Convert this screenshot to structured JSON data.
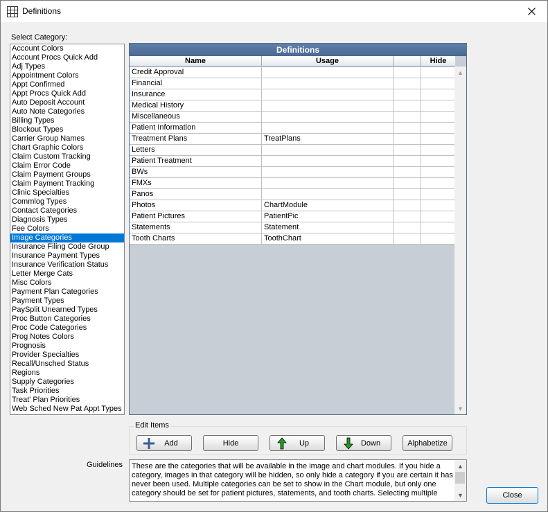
{
  "window": {
    "title": "Definitions",
    "icon": "grid-icon",
    "close_icon": "close-icon"
  },
  "category_label": "Select Category:",
  "categories": [
    "Account Colors",
    "Account Procs Quick Add",
    "Adj Types",
    "Appointment Colors",
    "Appt Confirmed",
    "Appt Procs Quick Add",
    "Auto Deposit Account",
    "Auto Note Categories",
    "Billing Types",
    "Blockout Types",
    "Carrier Group Names",
    "Chart Graphic Colors",
    "Claim Custom Tracking",
    "Claim Error Code",
    "Claim Payment Groups",
    "Claim Payment Tracking",
    "Clinic Specialties",
    "Commlog Types",
    "Contact Categories",
    "Diagnosis Types",
    "Fee Colors",
    "Image Categories",
    "Insurance Filing Code Group",
    "Insurance Payment Types",
    "Insurance Verification Status",
    "Letter Merge Cats",
    "Misc Colors",
    "Payment Plan Categories",
    "Payment Types",
    "PaySplit Unearned Types",
    "Proc Button Categories",
    "Proc Code Categories",
    "Prog Notes Colors",
    "Prognosis",
    "Provider Specialties",
    "Recall/Unsched Status",
    "Regions",
    "Supply Categories",
    "Task Priorities",
    "Treat' Plan Priorities",
    "Web Sched New Pat Appt Types"
  ],
  "selected_category": "Image Categories",
  "grid": {
    "title": "Definitions",
    "columns": [
      "Name",
      "Usage",
      "",
      "Hide"
    ],
    "rows": [
      {
        "name": "Credit Approval",
        "usage": "",
        "extra": "",
        "hide": ""
      },
      {
        "name": "Financial",
        "usage": "",
        "extra": "",
        "hide": ""
      },
      {
        "name": "Insurance",
        "usage": "",
        "extra": "",
        "hide": ""
      },
      {
        "name": "Medical History",
        "usage": "",
        "extra": "",
        "hide": ""
      },
      {
        "name": "Miscellaneous",
        "usage": "",
        "extra": "",
        "hide": ""
      },
      {
        "name": "Patient Information",
        "usage": "",
        "extra": "",
        "hide": ""
      },
      {
        "name": "Treatment Plans",
        "usage": "TreatPlans",
        "extra": "",
        "hide": ""
      },
      {
        "name": "Letters",
        "usage": "",
        "extra": "",
        "hide": ""
      },
      {
        "name": "Patient Treatment",
        "usage": "",
        "extra": "",
        "hide": ""
      },
      {
        "name": "BWs",
        "usage": "",
        "extra": "",
        "hide": ""
      },
      {
        "name": "FMXs",
        "usage": "",
        "extra": "",
        "hide": ""
      },
      {
        "name": "Panos",
        "usage": "",
        "extra": "",
        "hide": ""
      },
      {
        "name": "Photos",
        "usage": "ChartModule",
        "extra": "",
        "hide": ""
      },
      {
        "name": "Patient Pictures",
        "usage": "PatientPic",
        "extra": "",
        "hide": ""
      },
      {
        "name": "Statements",
        "usage": "Statement",
        "extra": "",
        "hide": ""
      },
      {
        "name": "Tooth Charts",
        "usage": "ToothChart",
        "extra": "",
        "hide": ""
      }
    ]
  },
  "edit_items": {
    "label": "Edit Items",
    "buttons": {
      "add": "Add",
      "hide": "Hide",
      "up": "Up",
      "down": "Down",
      "alphabetize": "Alphabetize"
    }
  },
  "guidelines": {
    "label": "Guidelines",
    "text": "These are the categories that will be available in the image and chart modules.  If you hide a category, images in that category will be hidden, so only hide a category if you are certain it has never been used.  Multiple categories can be set to show in the Chart module, but only one category should be set for patient pictures, statements, and tooth charts. Selecting multiple"
  },
  "close_button": "Close",
  "colors": {
    "selection": "#0078d7",
    "grid_title": "#4f6f9c",
    "grid_empty": "#c8ced6",
    "add_icon": "#3a5a98",
    "arrow_icon": "#1a8a1a"
  }
}
